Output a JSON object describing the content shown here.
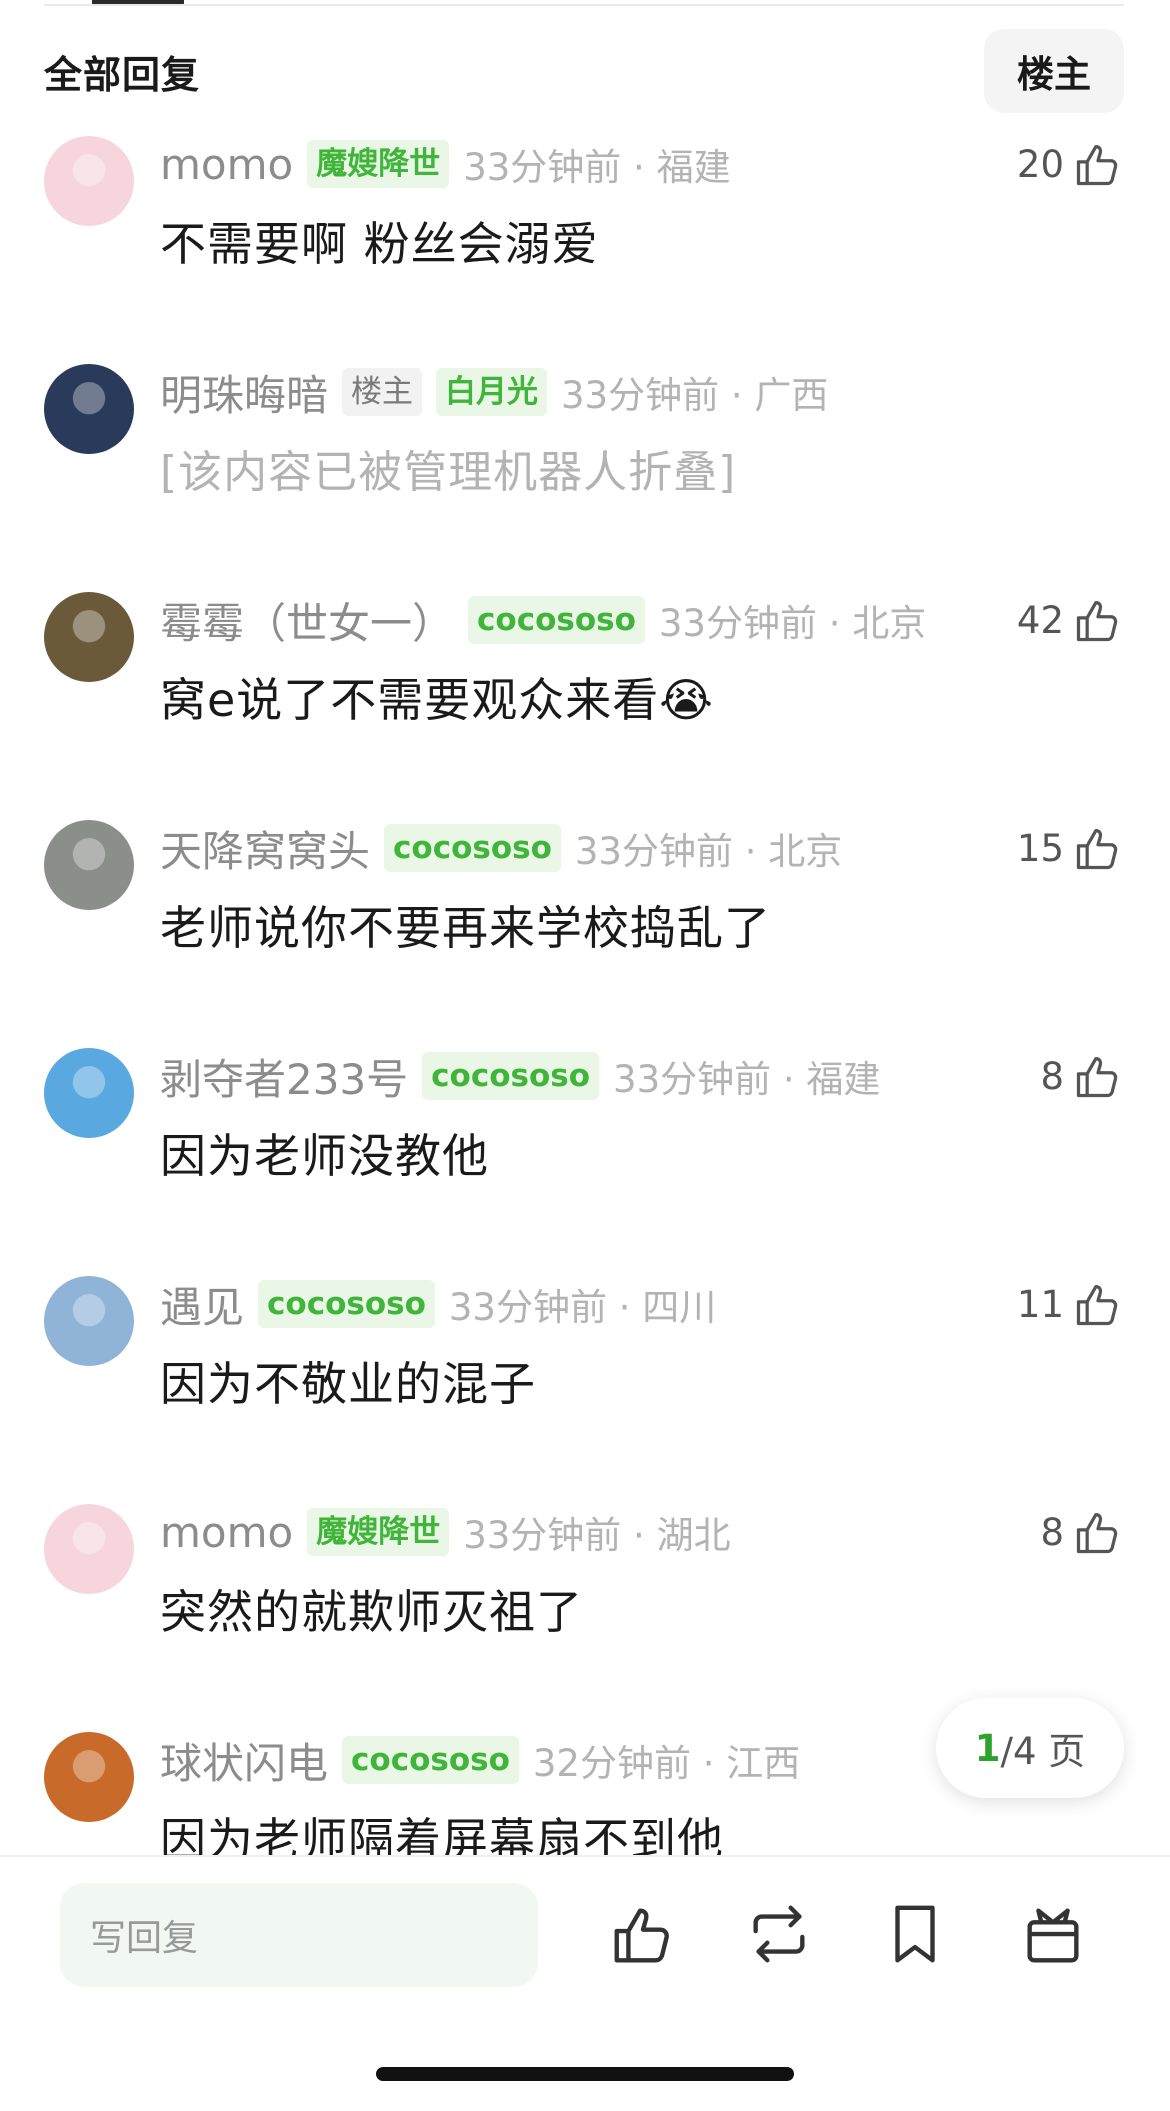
{
  "header": {
    "title": "全部回复",
    "filter_label": "楼主"
  },
  "comments": [
    {
      "name": "momo",
      "badges": [
        {
          "text": "魔嫂降世",
          "style": "green"
        }
      ],
      "time": "33分钟前 · 福建",
      "likes": "20",
      "body": "不需要啊 粉丝会溺爱",
      "avatar": "pink-creature-avatar",
      "avatar_color": "#f6d6dc"
    },
    {
      "name": "明珠晦暗",
      "badges": [
        {
          "text": "楼主",
          "style": "grey"
        },
        {
          "text": "白月光",
          "style": "green"
        }
      ],
      "time": "33分钟前 · 广西",
      "likes": "",
      "body": "[该内容已被管理机器人折叠]",
      "folded": true,
      "avatar": "red-hood-girl-avatar",
      "avatar_color": "#2a3a5a"
    },
    {
      "name": "霉霉（世女一）",
      "badges": [
        {
          "text": "cocososo",
          "style": "green"
        }
      ],
      "time": "33分钟前 · 北京",
      "likes": "42",
      "body": "窝e说了不需要观众来看😭",
      "avatar": "singer-avatar",
      "avatar_color": "#6a5a3a"
    },
    {
      "name": "天降窝窝头",
      "badges": [
        {
          "text": "cocososo",
          "style": "green"
        }
      ],
      "time": "33分钟前 · 北京",
      "likes": "15",
      "body": "老师说你不要再来学校捣乱了",
      "avatar": "panda-avatar",
      "avatar_color": "#8a8f8a"
    },
    {
      "name": "剥夺者233号",
      "badges": [
        {
          "text": "cocososo",
          "style": "green"
        }
      ],
      "time": "33分钟前 · 福建",
      "likes": "8",
      "body": "因为老师没教他",
      "avatar": "girl-photo-avatar",
      "avatar_color": "#5aa8e0"
    },
    {
      "name": "遇见",
      "badges": [
        {
          "text": "cocososo",
          "style": "green"
        }
      ],
      "time": "33分钟前 · 四川",
      "likes": "11",
      "body": "因为不敬业的混子",
      "avatar": "cat-avatar",
      "avatar_color": "#8fb4d8"
    },
    {
      "name": "momo",
      "badges": [
        {
          "text": "魔嫂降世",
          "style": "green"
        }
      ],
      "time": "33分钟前 · 湖北",
      "likes": "8",
      "body": "突然的就欺师灭祖了",
      "avatar": "pink-creature-avatar",
      "avatar_color": "#f6d6dc"
    },
    {
      "name": "球状闪电",
      "badges": [
        {
          "text": "cocososo",
          "style": "green"
        }
      ],
      "time": "32分钟前 · 江西",
      "likes": "",
      "body": "因为老师隔着屏幕扇不到他",
      "avatar": "cartoon-girl-avatar",
      "avatar_color": "#c86a2a"
    }
  ],
  "pager": {
    "current": "1",
    "total_text": "/4 页"
  },
  "bottom_bar": {
    "reply_placeholder": "写回复",
    "icons": [
      "thumbs-up-icon",
      "repost-icon",
      "bookmark-icon",
      "gift-icon"
    ]
  },
  "colors": {
    "accent_green": "#3fb53a",
    "muted_text": "#b3b3b3"
  }
}
